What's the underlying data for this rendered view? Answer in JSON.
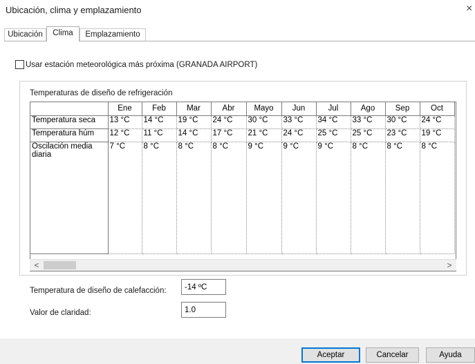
{
  "dialog": {
    "title": "Ubicación, clima y emplazamiento",
    "close_glyph": "×"
  },
  "tabs": [
    {
      "label": "Ubicación",
      "active": false
    },
    {
      "label": "Clima",
      "active": true
    },
    {
      "label": "Emplazamiento",
      "active": false
    }
  ],
  "weather_station": {
    "label": "Usar estación meteorológica más próxima (GRANADA AIRPORT)",
    "checked": false
  },
  "cooling": {
    "group_title": "Temperaturas de diseño de refrigeración",
    "columns": [
      "Ene",
      "Feb",
      "Mar",
      "Abr",
      "Mayo",
      "Jun",
      "Jul",
      "Ago",
      "Sep",
      "Oct"
    ],
    "rows": [
      {
        "label": "Temperatura seca",
        "values": [
          "13 °C",
          "14 °C",
          "19 °C",
          "24 °C",
          "30 °C",
          "33 °C",
          "34 °C",
          "33 °C",
          "30 °C",
          "24 °C"
        ]
      },
      {
        "label": "Temperatura húm",
        "values": [
          "12 °C",
          "11 °C",
          "14 °C",
          "17 °C",
          "21 °C",
          "24 °C",
          "25 °C",
          "25 °C",
          "23 °C",
          "19 °C"
        ]
      },
      {
        "label": "Oscilación media diaria",
        "values": [
          "7 °C",
          "8 °C",
          "8 °C",
          "8 °C",
          "9 °C",
          "9 °C",
          "9 °C",
          "8 °C",
          "8 °C",
          "8 °C"
        ]
      }
    ],
    "scroll_left": "<",
    "scroll_right": ">"
  },
  "heating": {
    "label": "Temperatura de diseño de calefacción:",
    "value": "-14 ºC"
  },
  "clearness": {
    "label": "Valor de claridad:",
    "value": "1.0"
  },
  "buttons": {
    "ok": "Aceptar",
    "cancel": "Cancelar",
    "help": "Ayuda"
  },
  "colors": {
    "default_button_border": "#0078d7",
    "footer_background": "#f0f0f0"
  }
}
